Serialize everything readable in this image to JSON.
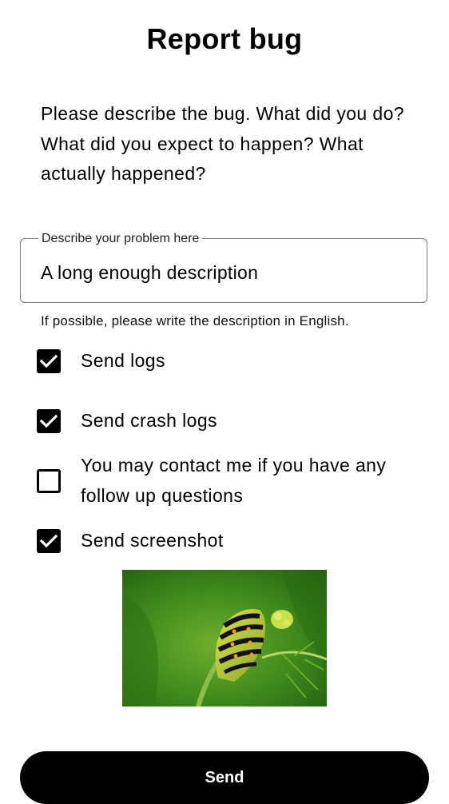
{
  "page": {
    "title": "Report bug",
    "intro": "Please describe the bug. What did you do? What did you expect to happen? What actually happened?"
  },
  "description_field": {
    "label": "Describe your problem here",
    "value": "A long enough description",
    "helper": "If possible, please write the description in English."
  },
  "options": [
    {
      "label": "Send logs",
      "checked": true
    },
    {
      "label": "Send crash logs",
      "checked": true
    },
    {
      "label": "You may contact me if you have any follow up questions",
      "checked": false
    },
    {
      "label": "Send screenshot",
      "checked": true
    }
  ],
  "screenshot_preview": {
    "icon": "caterpillar-photo"
  },
  "send_button": {
    "label": "Send"
  },
  "colors": {
    "accent": "#000000",
    "background": "#ffffff",
    "field_border": "#7a7a7a"
  }
}
